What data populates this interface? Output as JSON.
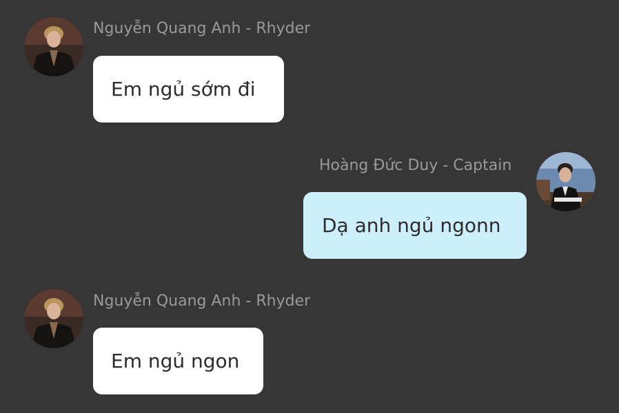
{
  "messages": [
    {
      "sender": "Nguyễn Quang Anh - Rhyder",
      "text": "Em ngủ sớm đi",
      "direction": "incoming"
    },
    {
      "sender": "Hoàng Đức Duy - Captain",
      "text": "Dạ anh ngủ ngonn",
      "direction": "outgoing"
    },
    {
      "sender": "Nguyễn Quang Anh - Rhyder",
      "text": "Em ngủ ngon",
      "direction": "incoming"
    }
  ],
  "colors": {
    "background": "#363636",
    "incoming_bubble": "#ffffff",
    "outgoing_bubble": "#cdeefb",
    "sender_name": "#9a9a9a",
    "message_text": "#2b2b2b"
  }
}
